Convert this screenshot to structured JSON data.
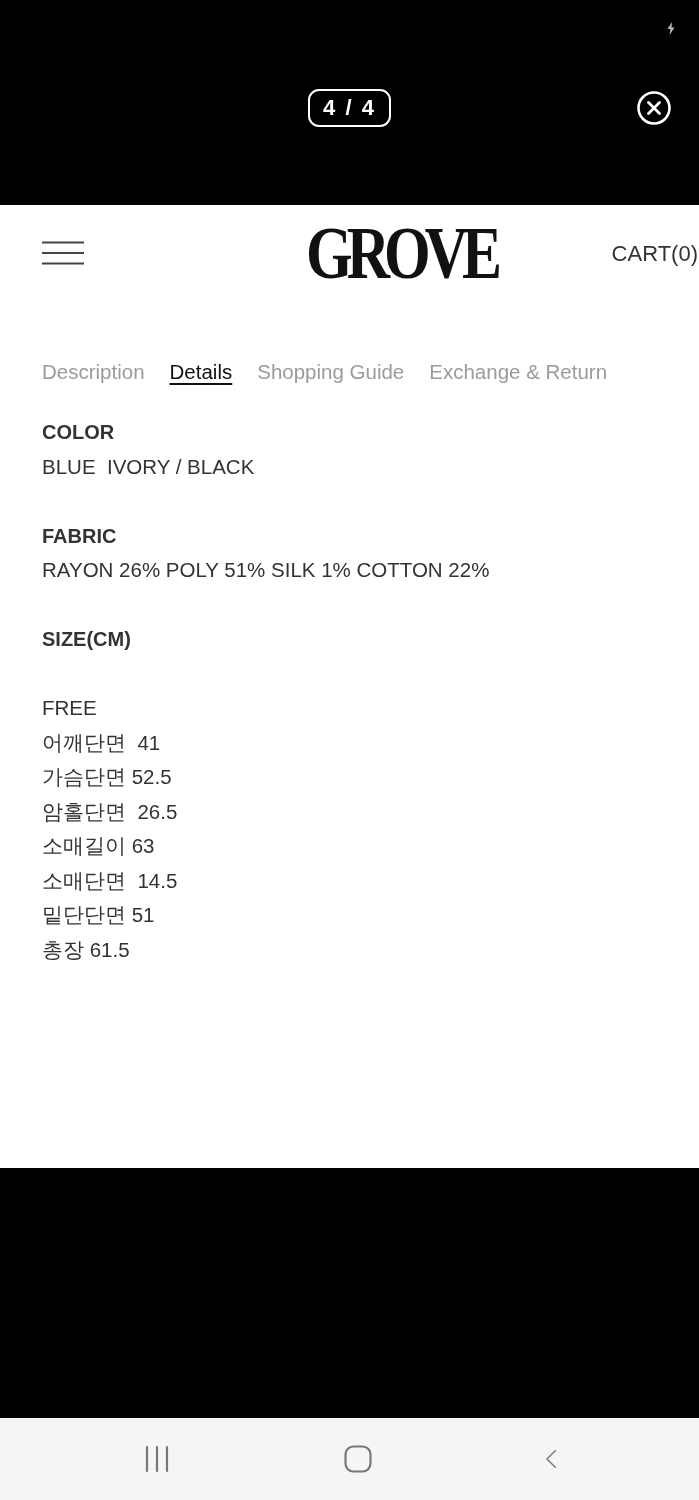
{
  "viewer": {
    "counter": "4 / 4"
  },
  "header": {
    "logo": "GROVE",
    "cart": "CART(0)"
  },
  "tabs": [
    {
      "label": "Description",
      "selected": false
    },
    {
      "label": "Details",
      "selected": true
    },
    {
      "label": "Shopping Guide",
      "selected": false
    },
    {
      "label": "Exchange & Return",
      "selected": false
    }
  ],
  "sections": [
    {
      "kind": "text",
      "heading": "COLOR",
      "lines": [
        "BLUE  IVORY / BLACK"
      ]
    },
    {
      "kind": "text",
      "heading": "FABRIC",
      "lines": [
        "RAYON 26% POLY 51% SILK 1% COTTON 22%"
      ]
    },
    {
      "kind": "size",
      "heading": "SIZE(CM)",
      "lines": [
        "FREE",
        "어깨단면  41",
        "가슴단면 52.5",
        "암홀단면  26.5",
        "소매길이 63",
        "소매단면  14.5",
        "밑단단면 51",
        "총장 61.5"
      ]
    }
  ]
}
